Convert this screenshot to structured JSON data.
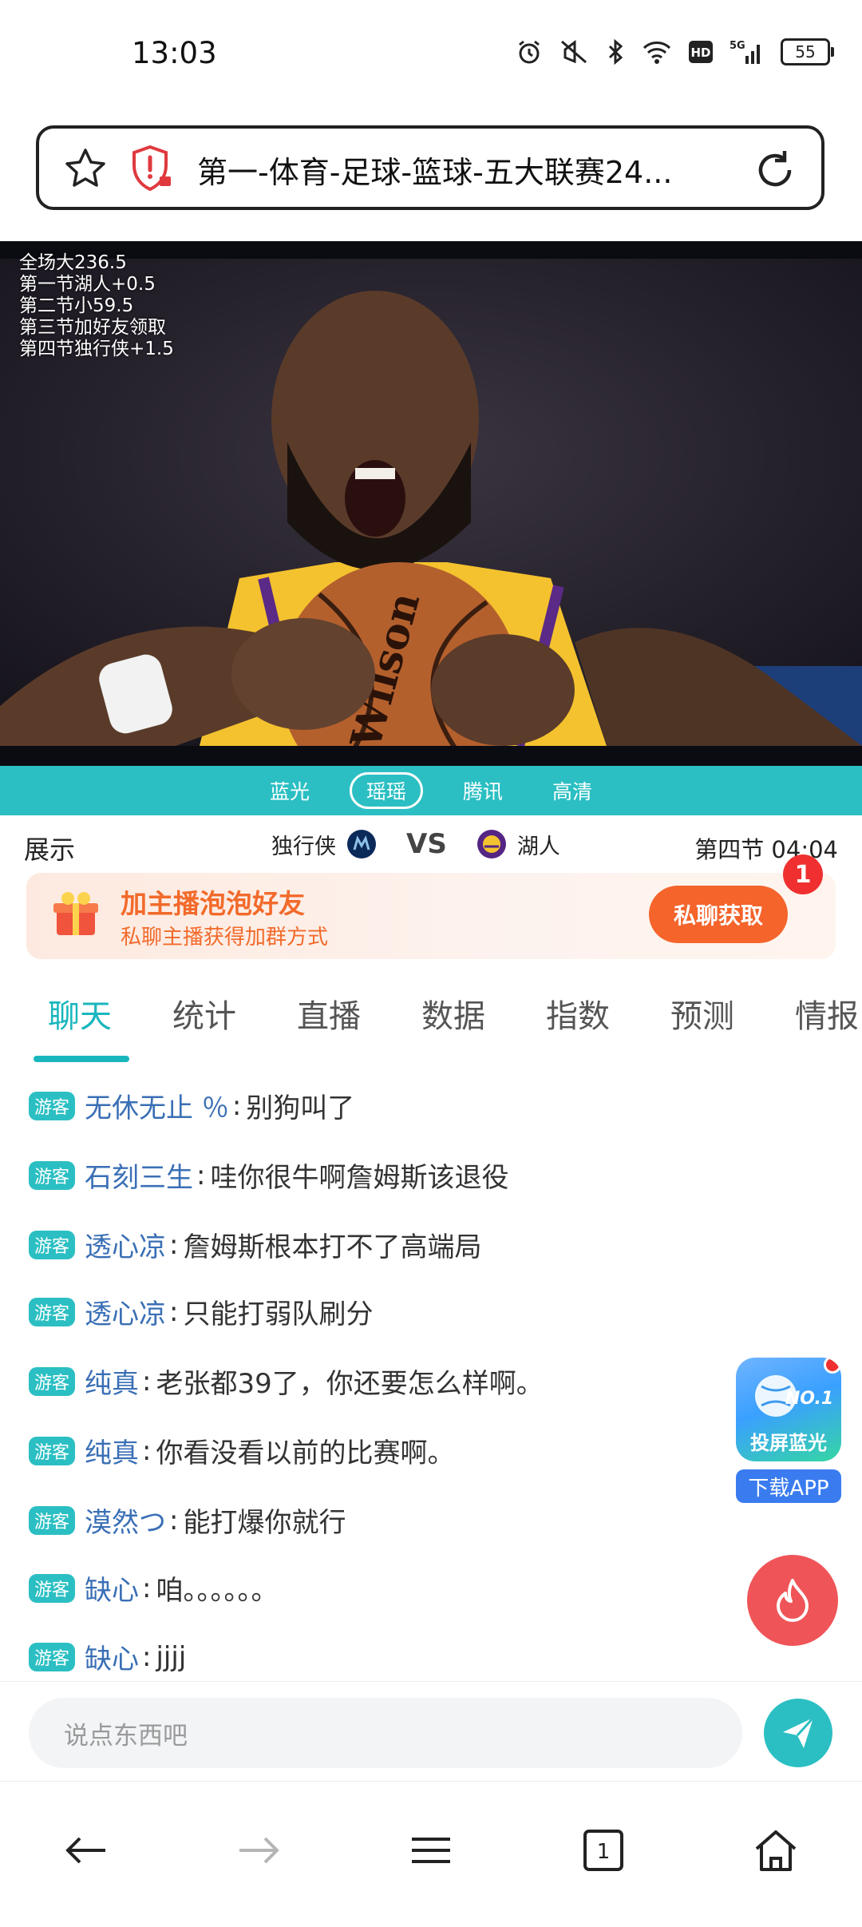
{
  "status": {
    "time": "13:03",
    "battery": "55"
  },
  "browser": {
    "url_title": "第一-体育-足球-篮球-五大联赛24..."
  },
  "video": {
    "overlay_lines": [
      "全场大236.5",
      "第一节湖人+0.5",
      "第二节小59.5",
      "第三节加好友领取",
      "第四节独行侠+1.5"
    ]
  },
  "sources": [
    "蓝光",
    "瑶瑶",
    "腾讯",
    "高清"
  ],
  "score": {
    "display_label": "展示",
    "away_team": "独行侠",
    "vs": "VS",
    "home_team": "湖人",
    "quarter_time": "第四节 04:04"
  },
  "promo": {
    "title": "加主播泡泡好友",
    "subtitle": "私聊主播获得加群方式",
    "cta": "私聊获取",
    "badge": "1"
  },
  "tabs": [
    "聊天",
    "统计",
    "直播",
    "数据",
    "指数",
    "预测",
    "情报"
  ],
  "chat": {
    "guest_badge": "游客",
    "messages": [
      {
        "user": "无休无止 ％",
        "text": "别狗叫了"
      },
      {
        "user": "石刻三生",
        "text": "哇你很牛啊詹姆斯该退役"
      },
      {
        "user": "透心凉",
        "text": "詹姆斯根本打不了高端局"
      },
      {
        "user": "透心凉",
        "text": "只能打弱队刷分"
      },
      {
        "user": "纯真",
        "text": "老张都39了，你还要怎么样啊。"
      },
      {
        "user": "纯真",
        "text": "你看没看以前的比赛啊。"
      },
      {
        "user": "漠然つ",
        "text": "能打爆你就行"
      },
      {
        "user": "缺心",
        "text": "咱。。。。。。"
      },
      {
        "user": "缺心",
        "text": "jjjj"
      }
    ]
  },
  "floating": {
    "app_tile_label": "投屏蓝光",
    "app_tile_logo": "NO.1",
    "download": "下载APP"
  },
  "input": {
    "placeholder": "说点东西吧"
  },
  "nav": {
    "tab_count": "1"
  },
  "colors": {
    "accent": "#2bbfc3",
    "promo_orange": "#f4642b",
    "username_blue": "#3a6fb5"
  }
}
